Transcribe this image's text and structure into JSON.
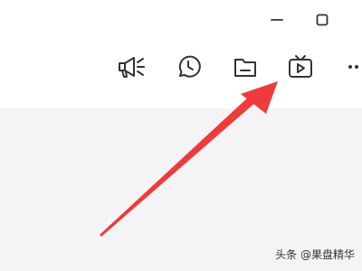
{
  "window_controls": {
    "minimize_icon": "minimize-icon",
    "maximize_icon": "maximize-icon"
  },
  "toolbar": {
    "items": [
      {
        "icon": "megaphone-icon"
      },
      {
        "icon": "clock-icon"
      },
      {
        "icon": "folder-icon"
      },
      {
        "icon": "tv-icon"
      },
      {
        "icon": "more-icon"
      }
    ],
    "icon_color": "#333333"
  },
  "annotation": {
    "arrow_color": "#ee3b3b"
  },
  "watermark": {
    "text": "头条 @果盘精华"
  },
  "colors": {
    "top_background": "#ffffff",
    "content_background": "#f4f4f6"
  }
}
